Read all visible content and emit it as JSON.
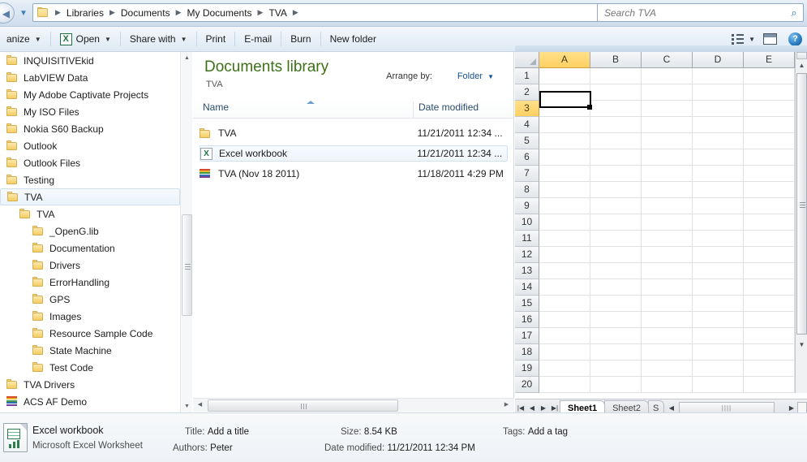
{
  "window": {
    "address": {
      "crumbs": [
        "Libraries",
        "Documents",
        "My Documents",
        "TVA"
      ],
      "dropdown_icon": "chevron-down-icon",
      "refresh_icon": "refresh-icon",
      "back_icon": "back-arrow-icon",
      "recent_icon": "recent-pages-icon"
    },
    "search": {
      "placeholder": "Search TVA",
      "icon": "search-icon"
    }
  },
  "toolbar": {
    "organize": "anize",
    "open": "Open",
    "share_with": "Share with",
    "print": "Print",
    "email": "E-mail",
    "burn": "Burn",
    "new_folder": "New folder",
    "caret": "▼",
    "view_icon": "view-options-icon",
    "pane_icon": "preview-pane-icon",
    "help_icon": "help-icon"
  },
  "nav_tree": {
    "items": [
      {
        "label": "INQUISITIVEkid",
        "indent": 0,
        "icon": "folder-icon",
        "selected": false
      },
      {
        "label": "LabVIEW Data",
        "indent": 0,
        "icon": "folder-icon",
        "selected": false
      },
      {
        "label": "My Adobe Captivate Projects",
        "indent": 0,
        "icon": "folder-icon",
        "selected": false
      },
      {
        "label": "My ISO Files",
        "indent": 0,
        "icon": "folder-icon",
        "selected": false
      },
      {
        "label": "Nokia S60 Backup",
        "indent": 0,
        "icon": "folder-icon",
        "selected": false
      },
      {
        "label": "Outlook",
        "indent": 0,
        "icon": "folder-icon",
        "selected": false
      },
      {
        "label": "Outlook Files",
        "indent": 0,
        "icon": "folder-icon",
        "selected": false
      },
      {
        "label": "Testing",
        "indent": 0,
        "icon": "folder-icon",
        "selected": false
      },
      {
        "label": "TVA",
        "indent": 0,
        "icon": "folder-icon",
        "selected": true
      },
      {
        "label": "TVA",
        "indent": 1,
        "icon": "folder-icon",
        "selected": false
      },
      {
        "label": "_OpenG.lib",
        "indent": 2,
        "icon": "folder-icon",
        "selected": false
      },
      {
        "label": "Documentation",
        "indent": 2,
        "icon": "folder-icon",
        "selected": false
      },
      {
        "label": "Drivers",
        "indent": 2,
        "icon": "folder-icon",
        "selected": false
      },
      {
        "label": "ErrorHandling",
        "indent": 2,
        "icon": "folder-icon",
        "selected": false
      },
      {
        "label": "GPS",
        "indent": 2,
        "icon": "folder-icon",
        "selected": false
      },
      {
        "label": "Images",
        "indent": 2,
        "icon": "folder-icon",
        "selected": false
      },
      {
        "label": "Resource Sample Code",
        "indent": 2,
        "icon": "folder-icon",
        "selected": false
      },
      {
        "label": "State Machine",
        "indent": 2,
        "icon": "folder-icon",
        "selected": false
      },
      {
        "label": "Test Code",
        "indent": 2,
        "icon": "folder-icon",
        "selected": false
      },
      {
        "label": "TVA Drivers",
        "indent": 0,
        "icon": "folder-icon",
        "selected": false
      },
      {
        "label": "ACS AF Demo",
        "indent": 0,
        "icon": "archive-icon",
        "selected": false
      }
    ]
  },
  "content": {
    "library_title": "Documents library",
    "library_subtitle": "TVA",
    "arrange_label": "Arrange by:",
    "arrange_value": "Folder",
    "columns": {
      "name": "Name",
      "date_modified": "Date modified"
    },
    "files": [
      {
        "name": "TVA",
        "date": "11/21/2011 12:34 ...",
        "icon": "folder-icon",
        "selected": false
      },
      {
        "name": "Excel workbook",
        "date": "11/21/2011 12:34 ...",
        "icon": "excel-file-icon",
        "selected": true
      },
      {
        "name": "TVA (Nov 18 2011)",
        "date": "11/18/2011 4:29 PM",
        "icon": "archive-icon",
        "selected": false
      }
    ]
  },
  "excel": {
    "columns": [
      "A",
      "B",
      "C",
      "D",
      "E"
    ],
    "active_column": "A",
    "rows": [
      "1",
      "2",
      "3",
      "4",
      "5",
      "6",
      "7",
      "8",
      "9",
      "10",
      "11",
      "12",
      "13",
      "14",
      "15",
      "16",
      "17",
      "18",
      "19",
      "20"
    ],
    "active_row": "3",
    "active_cell": "A3",
    "sheet_tabs": [
      {
        "label": "Sheet1",
        "active": true
      },
      {
        "label": "Sheet2",
        "active": false
      },
      {
        "label": "S",
        "active": false
      }
    ],
    "nav_first": "|◀",
    "nav_prev": "◀",
    "nav_next": "▶",
    "nav_last": "▶|",
    "hscroll_left": "◀",
    "hscroll_right": "▶",
    "hscroll_grip": "||||"
  },
  "details": {
    "file_name": "Excel workbook",
    "file_type": "Microsoft Excel Worksheet",
    "title_key": "Title:",
    "title_value": "Add a title",
    "authors_key": "Authors:",
    "authors_value": "Peter",
    "size_key": "Size:",
    "size_value": "8.54 KB",
    "date_key": "Date modified:",
    "date_value": "11/21/2011 12:34 PM",
    "tags_key": "Tags:",
    "tags_value": "Add a tag",
    "icon": "excel-document-icon"
  }
}
